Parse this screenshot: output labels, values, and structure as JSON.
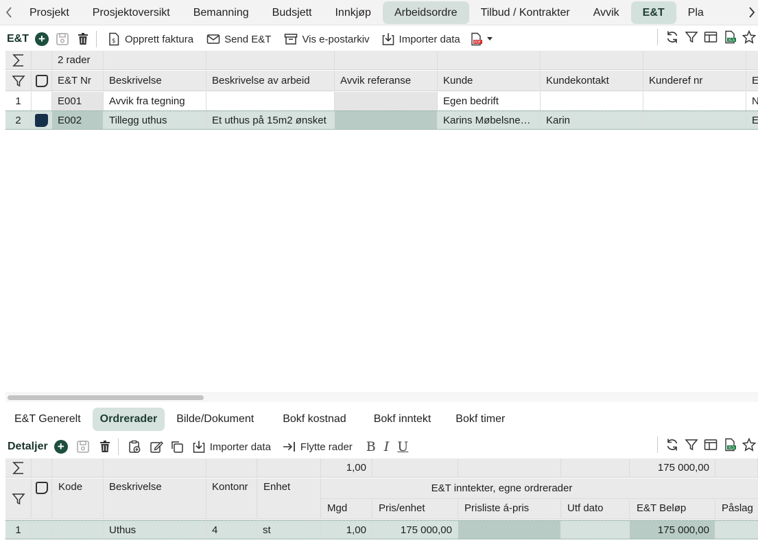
{
  "top_tabs": [
    {
      "label": "Prosjekt"
    },
    {
      "label": "Prosjektoversikt"
    },
    {
      "label": "Bemanning"
    },
    {
      "label": "Budsjett"
    },
    {
      "label": "Innkjøp"
    },
    {
      "label": "Arbeidsordre"
    },
    {
      "label": "Tilbud / Kontrakter"
    },
    {
      "label": "Avvik"
    },
    {
      "label": "E&T"
    },
    {
      "label": "Pla"
    }
  ],
  "main_toolbar": {
    "title": "E&T",
    "create_invoice": "Opprett faktura",
    "send": "Send E&T",
    "email_archive": "Vis e-postarkiv",
    "import": "Importer data"
  },
  "main_grid": {
    "row_count": "2 rader",
    "columns": [
      "E&T Nr",
      "Beskrivelse",
      "Beskrivelse av arbeid",
      "Avvik referanse",
      "Kunde",
      "Kundekontakt",
      "Kunderef nr",
      "E"
    ],
    "rows": [
      {
        "num": "1",
        "nr": "E001",
        "beskrivelse": "Avvik fra tegning",
        "arbeid": "",
        "avvik": "",
        "kunde": "Egen bedrift",
        "kontakt": "",
        "ref": "",
        "extra": "N"
      },
      {
        "num": "2",
        "nr": "E002",
        "beskrivelse": "Tillegg uthus",
        "arbeid": "Et uthus på 15m2 ønsket",
        "avvik": "",
        "kunde": "Karins Møbelsnekkeri",
        "kontakt": "Karin",
        "ref": "",
        "extra": "E"
      }
    ]
  },
  "sub_tabs": [
    {
      "label": "E&T Generelt"
    },
    {
      "label": "Ordrerader"
    },
    {
      "label": "Bilde/Dokument"
    },
    {
      "label": "Bokf kostnad"
    },
    {
      "label": "Bokf inntekt"
    },
    {
      "label": "Bokf timer"
    }
  ],
  "detail_toolbar": {
    "title": "Detaljer",
    "import": "Importer data",
    "move_rows": "Flytte rader",
    "bold": "B",
    "italic": "I",
    "underline": "U"
  },
  "detail_grid": {
    "sum_qty": "1,00",
    "sum_amount": "175 000,00",
    "columns": {
      "kode": "Kode",
      "beskrivelse": "Beskrivelse",
      "kontonr": "Kontonr",
      "enhet": "Enhet",
      "group": "E&T inntekter, egne ordrerader",
      "mgd": "Mgd",
      "pris": "Pris/enhet",
      "prisliste": "Prisliste á-pris",
      "utf": "Utf dato",
      "belop": "E&T Beløp",
      "paslag": "Påslag"
    },
    "rows": [
      {
        "num": "1",
        "kode": "",
        "beskrivelse": "Uthus",
        "kontonr": "4",
        "enhet": "st",
        "mgd": "1,00",
        "pris": "175 000,00",
        "prisliste": "",
        "utf": "",
        "belop": "175 000,00",
        "paslag": ""
      }
    ]
  }
}
